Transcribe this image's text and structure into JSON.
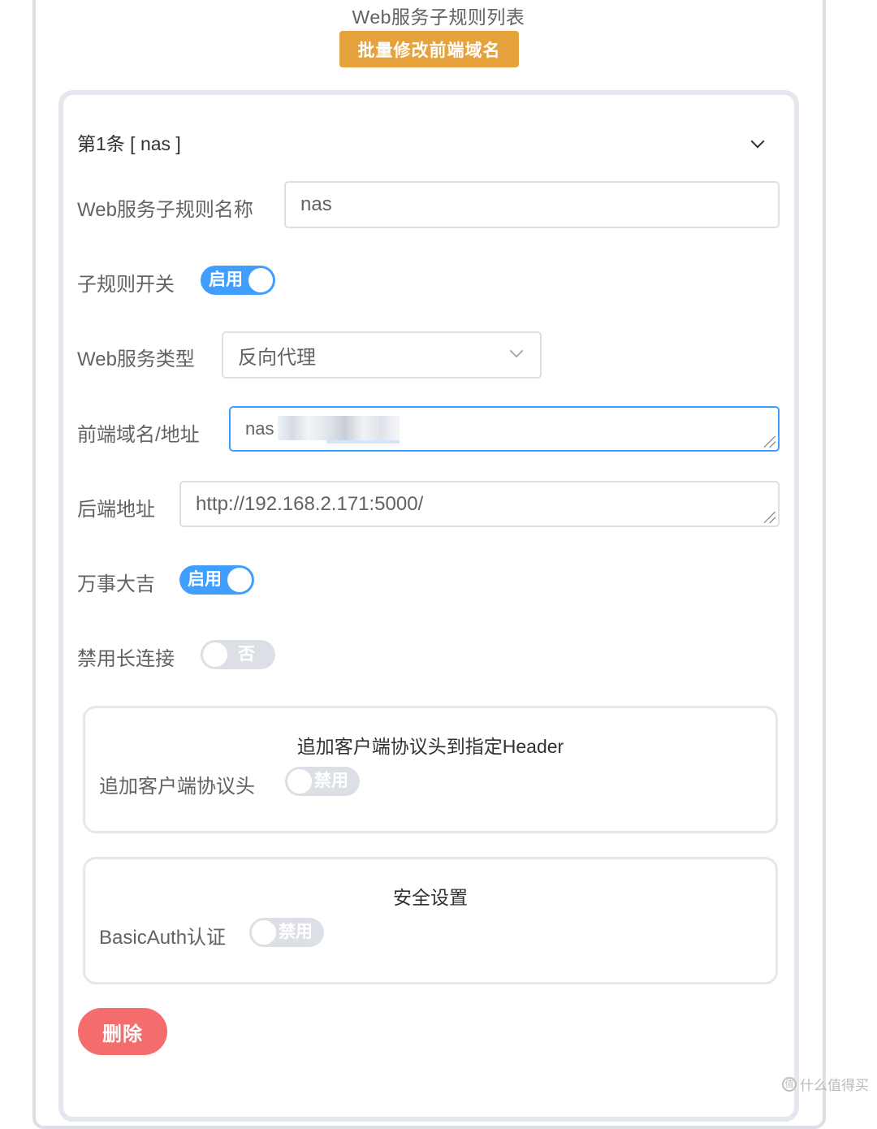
{
  "page": {
    "title": "Web服务子规则列表",
    "batch_button": "批量修改前端域名"
  },
  "rule": {
    "header": "第1条 [ nas ]",
    "name_label": "Web服务子规则名称",
    "name_value": "nas",
    "enable_label": "子规则开关",
    "enable_switch_text": "启用",
    "enable_state": true,
    "type_label": "Web服务类型",
    "type_value": "反向代理",
    "frontend_label": "前端域名/地址",
    "frontend_value": "nas",
    "backend_label": "后端地址",
    "backend_value": "http://192.168.2.171:5000/",
    "lucky_label": "万事大吉",
    "lucky_switch_text": "启用",
    "lucky_state": true,
    "keepalive_label": "禁用长连接",
    "keepalive_switch_text": "否",
    "keepalive_state": false
  },
  "client_header": {
    "title": "追加客户端协议头到指定Header",
    "label": "追加客户端协议头",
    "switch_text": "禁用",
    "state": false
  },
  "security": {
    "title": "安全设置",
    "label": "BasicAuth认证",
    "switch_text": "禁用",
    "state": false
  },
  "delete_button": "删除",
  "watermark": "什么值得买",
  "colors": {
    "accent": "#409eff",
    "warning": "#e6a23c",
    "danger": "#f56c6c",
    "switch_off": "#dcdfe6"
  }
}
